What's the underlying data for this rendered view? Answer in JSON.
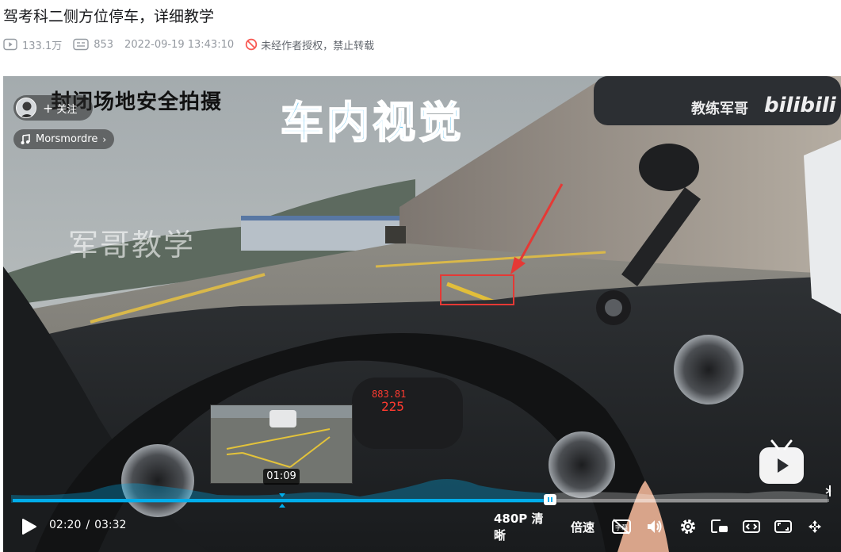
{
  "header": {
    "title": "驾考科二侧方位停车，详细教学",
    "views": "133.1万",
    "danmaku": "853",
    "datetime": "2022-09-19 13:43:10",
    "notice": "未经作者授权，禁止转载"
  },
  "player": {
    "follow_label": "关注",
    "music_label": "Morsmordre",
    "overlay": {
      "site": "封闭场地安全拍摄",
      "view": "车内视觉",
      "watermark": "军哥教学",
      "coach": "教练军哥",
      "logo": "bilibili"
    },
    "preview_time": "01:09",
    "progress": 0.658,
    "hover_position": 0.33,
    "current_time": "02:20",
    "time_separator": "/",
    "duration": "03:32",
    "quality": "480P 清晰",
    "speed": "倍速",
    "subtitle_badge": "字幕"
  },
  "colors": {
    "accent": "#00aeec",
    "warning": "#f85a54",
    "view_text": "#6ec6f0"
  },
  "icons": [
    "play-count-icon",
    "danmaku-count-icon",
    "no-repost-icon",
    "music-note-icon",
    "play-icon",
    "subtitle-off-icon",
    "volume-icon",
    "settings-icon",
    "pip-icon",
    "widescreen-icon",
    "web-fullscreen-icon",
    "fullscreen-icon",
    "tv-mascot-icon"
  ]
}
